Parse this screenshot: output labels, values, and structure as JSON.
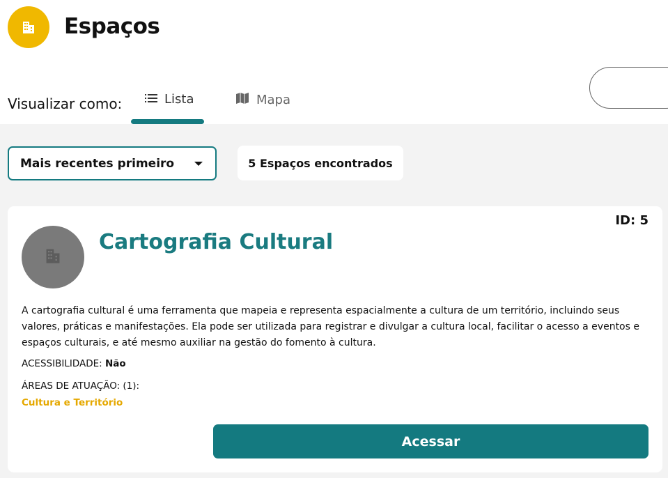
{
  "header": {
    "title": "Espaços",
    "icon": "building-icon",
    "icon_color": "#f0b800"
  },
  "view": {
    "label": "Visualizar como:",
    "tabs": [
      {
        "label": "Lista",
        "icon": "list-icon",
        "active": true
      },
      {
        "label": "Mapa",
        "icon": "map-icon",
        "active": false
      }
    ],
    "accent": "#147a80"
  },
  "filters": {
    "sort_selected": "Mais recentes primeiro",
    "results_count": "5 Espaços encontrados"
  },
  "cards": [
    {
      "id_label": "ID: 5",
      "title": "Cartografia Cultural",
      "description": "A cartografia cultural é uma ferramenta que mapeia e representa espacialmente a cultura de um território, incluindo seus valores, práticas e manifestações. Ela pode ser utilizada para registrar e divulgar a cultura local, facilitar o acesso a eventos e espaços culturais, e até mesmo auxiliar na gestão do fomento à cultura.",
      "accessibility_label": "ACESSIBILIDADE:",
      "accessibility_value": "Não",
      "areas_label": "ÁREAS DE ATUAÇÃO: (1):",
      "areas_value": "Cultura e Território",
      "button_label": "Acessar",
      "title_color": "#1a7b80",
      "area_color": "#e5a800"
    }
  ]
}
